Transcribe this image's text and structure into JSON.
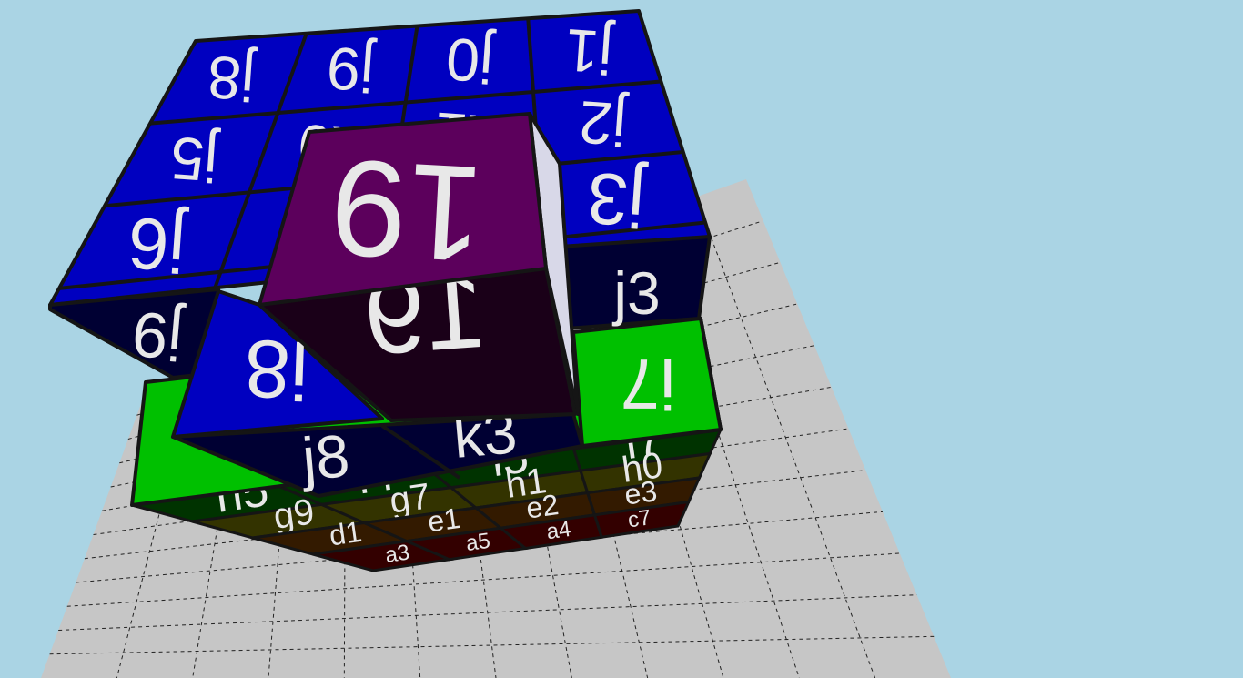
{
  "scene": {
    "colors": {
      "sky": "#aad4e4",
      "floor": "#c6c6c6",
      "blue": "#0000c0",
      "navy": "#000033",
      "green": "#00c000",
      "dark_green": "#003300",
      "olive": "#333300",
      "brown": "#331a00",
      "dark_red": "#330000",
      "purple": "#5c005c",
      "dark_purple": "#1a0018"
    },
    "top_face_labels": [
      "j8",
      "j9",
      "j0",
      "j1",
      "j5",
      "k0",
      "k1",
      "j2",
      "j6",
      "j3"
    ],
    "side_labels": {
      "left_navy": "j9",
      "right_navy": "j3",
      "blue_front": "i8",
      "green_right": "i7"
    },
    "moving_piece": {
      "top": "19",
      "front": "19"
    },
    "navy_row": [
      "j8",
      "k3"
    ],
    "underside_rows": [
      [
        "h5",
        "i4",
        "i5",
        "i7"
      ],
      [
        "g9",
        "g7",
        "h1",
        "h0"
      ],
      [
        "d1",
        "e1",
        "e2",
        "e3"
      ],
      [
        "a3",
        "a5",
        "a4",
        "c7"
      ]
    ]
  }
}
